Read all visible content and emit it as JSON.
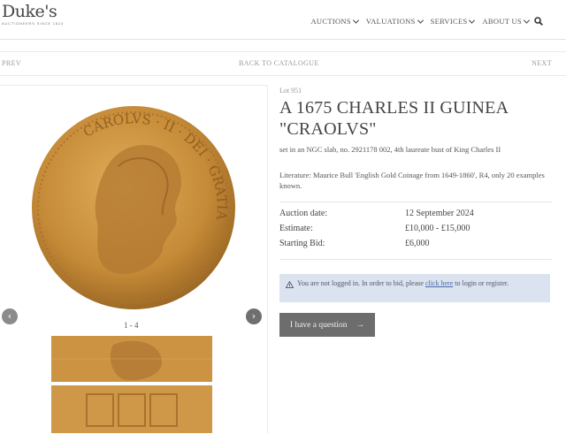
{
  "header": {
    "logo": "Duke's",
    "logo_tagline": "AUCTIONEERS SINCE 1823",
    "nav": [
      {
        "label": "AUCTIONS"
      },
      {
        "label": "VALUATIONS"
      },
      {
        "label": "SERVICES"
      },
      {
        "label": "ABOUT US"
      }
    ]
  },
  "subnav": {
    "prev": "PREV",
    "back": "BACK TO CATALOGUE",
    "next": "NEXT"
  },
  "gallery": {
    "counter": "1 - 4",
    "prev_arrow": "‹",
    "next_arrow": "›"
  },
  "lot": {
    "number": "Lot 951",
    "title": "A 1675 CHARLES II GUINEA \"CRAOLVS\"",
    "description": "set in an NGC slab, no. 2921178 002, 4th laureate bust of King Charles II",
    "literature": "Literature: Maurice Bull 'English Gold Coinage from 1649-1860', R4, only 20 examples known.",
    "details": [
      {
        "label": "Auction date:",
        "value": "12 September 2024"
      },
      {
        "label": "Estimate:",
        "value": "£10,000 - £15,000"
      },
      {
        "label": "Starting Bid:",
        "value": "£6,000"
      }
    ]
  },
  "notice": {
    "text_before": "You are not logged in. In order to bid, please ",
    "link": "click here",
    "text_after": " to login or register."
  },
  "question_button": {
    "label": "I have a question",
    "arrow": "→"
  },
  "colors": {
    "coin_gold": "#c9913d",
    "notice_bg": "#dbe3f0",
    "button_bg": "#6d6d6d"
  }
}
